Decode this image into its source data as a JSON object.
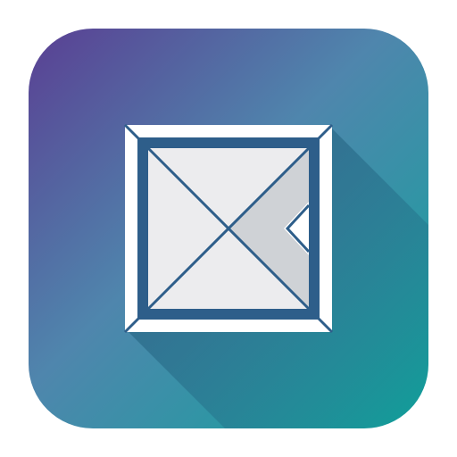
{
  "icon": {
    "name": "mail-envelope-app-icon",
    "glyph": "envelope-icon",
    "colors": {
      "gradient_top_left": "#5a3f93",
      "gradient_mid": "#4f86ad",
      "gradient_bottom_right": "#0ea59c",
      "gradient_light": "#56b9c2",
      "frame": "#ffffff",
      "inner_border": "#2e5e8a",
      "envelope_fill": "#e9e9ec",
      "envelope_shade": "#cfd2d6",
      "long_shadow": "#1e5c7a"
    }
  }
}
